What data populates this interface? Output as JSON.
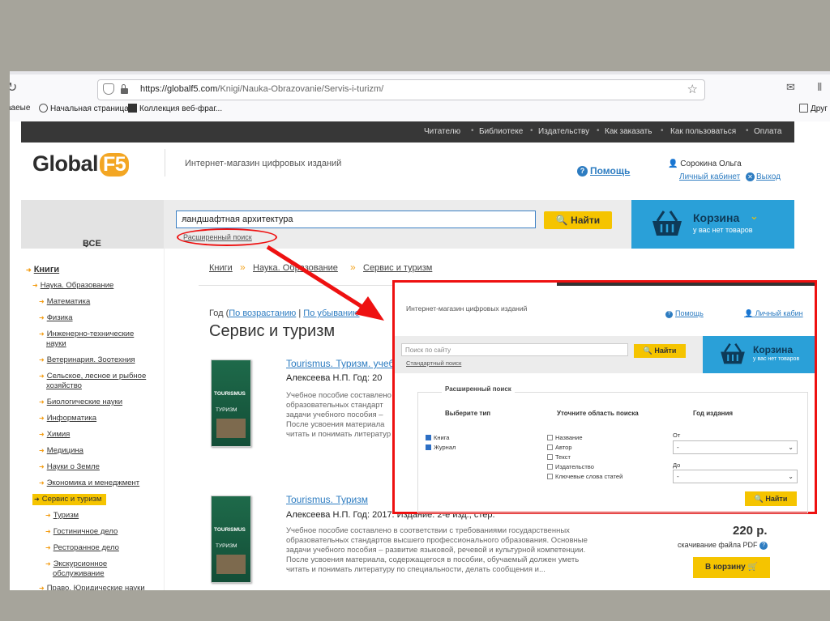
{
  "browser": {
    "url_host": "https://globalf5.com",
    "url_path": "/Knigi/Nauka-Obrazovanie/Servis-i-turizm/",
    "bookmarks": [
      {
        "label": "ааеые",
        "icon": "none"
      },
      {
        "label": "Начальная страница",
        "icon": "globe-icon"
      },
      {
        "label": "Коллекция веб-фраг...",
        "icon": "microsoft-icon"
      },
      {
        "label": "Друг",
        "icon": "folder-icon"
      }
    ]
  },
  "site": {
    "topnav": [
      "Читателю",
      "Библиотеке",
      "Издательству",
      "Как заказать",
      "Как пользоваться",
      "Оплата"
    ],
    "logo_text": "Global",
    "logo_badge": "F5",
    "tagline": "Интернет-магазин цифровых изданий",
    "help": "Помощь",
    "user_name": "Сорокина Ольга",
    "cabinet": "Личный кабинет",
    "logout": "Выход",
    "all_sections": "ВСЕ РАЗДЕЛЫ",
    "search": {
      "value": "ландшафтная архитектура",
      "button": "Найти",
      "advanced": "Расширенный поиск"
    },
    "cart": {
      "title": "Корзина",
      "subtitle": "у вас нет товаров"
    }
  },
  "sidebar": {
    "items": [
      {
        "label": "Книги"
      },
      {
        "label": "Наука. Образование"
      },
      {
        "label": "Математика"
      },
      {
        "label": "Физика"
      },
      {
        "label": "Инженерно-технические"
      },
      {
        "label": "науки"
      },
      {
        "label": "Ветеринария. Зоотехния"
      },
      {
        "label": "Сельское, лесное и рыбное"
      },
      {
        "label": "хозяйство"
      },
      {
        "label": "Биологические науки"
      },
      {
        "label": "Информатика"
      },
      {
        "label": "Химия"
      },
      {
        "label": "Медицина"
      },
      {
        "label": "Науки о Земле"
      },
      {
        "label": "Экономика и менеджмент"
      },
      {
        "label": "Сервис и туризм"
      },
      {
        "label": "Туризм"
      },
      {
        "label": "Гостиничное дело"
      },
      {
        "label": "Ресторанное дело"
      },
      {
        "label": "Экскурсионное"
      },
      {
        "label": "обслуживание"
      },
      {
        "label": "Право. Юридические науки"
      }
    ]
  },
  "main": {
    "breadcrumb": [
      "Книги",
      "Наука. Образование",
      "Сервис и туризм"
    ],
    "sort": {
      "prefix": "Год (",
      "asc": "По возрастанию",
      "sep": " | ",
      "desc": "По убыванию"
    },
    "title": "Сервис и туризм",
    "books": [
      {
        "title": "Tourismus. Туризм. учеб",
        "author": "Алексеева Н.П. Год: 20",
        "cover_title": "TOURISMUS",
        "cover_sub": "ТУРИЗМ",
        "desc": [
          "Учебное пособие составлено",
          "образовательных стандарт",
          "задачи учебного пособия –",
          "После усвоения материала",
          "читать и понимать литератур"
        ]
      },
      {
        "title": "Tourismus. Туризм",
        "author": "Алексеева Н.П. Год: 2017. Издание: 2-е изд., стер.",
        "cover_title": "TOURISMUS",
        "cover_sub": "ТУРИЗМ",
        "desc": [
          "Учебное пособие составлено в соответствии с требованиями государственных",
          "образовательных стандартов высшего профессионального образования. Основные",
          "задачи учебного пособия – развитие языковой, речевой и культурной компетенции.",
          "После усвоения материала, содержащегося в пособии, обучаемый должен уметь",
          "читать и понимать литературу по специальности, делать сообщения и..."
        ]
      }
    ],
    "price": "220 р.",
    "pdf_label": "скачивание файла PDF",
    "to_cart": "В корзину"
  },
  "overlay": {
    "tagline": "Интернет-магазин цифровых изданий",
    "help": "Помощь",
    "cabinet": "Личный кабин",
    "search_placeholder": "Поиск по сайту",
    "find": "Найти",
    "advanced": "Стандартный поиск",
    "cart_title": "Корзина",
    "cart_sub": "у вас нет товаров",
    "legend": "Расширенный поиск",
    "col1_header": "Выберите тип",
    "col2_header": "Уточните область поиска",
    "col3_header": "Год издания",
    "types": [
      {
        "label": "Книга",
        "checked": true
      },
      {
        "label": "Журнал",
        "checked": true
      }
    ],
    "areas": [
      {
        "label": "Название",
        "checked": false
      },
      {
        "label": "Автор",
        "checked": false
      },
      {
        "label": "Текст",
        "checked": false
      },
      {
        "label": "Издательство",
        "checked": false
      },
      {
        "label": "Ключевые слова статей",
        "checked": false
      }
    ],
    "from_label": "От",
    "to_label": "До",
    "from_value": "-",
    "to_value": "-",
    "find2": "Найти"
  },
  "colors": {
    "accent_yellow": "#f5c400",
    "cart_blue": "#2aa0d8",
    "link_blue": "#2d7cc1",
    "highlight_red": "#e11111"
  }
}
